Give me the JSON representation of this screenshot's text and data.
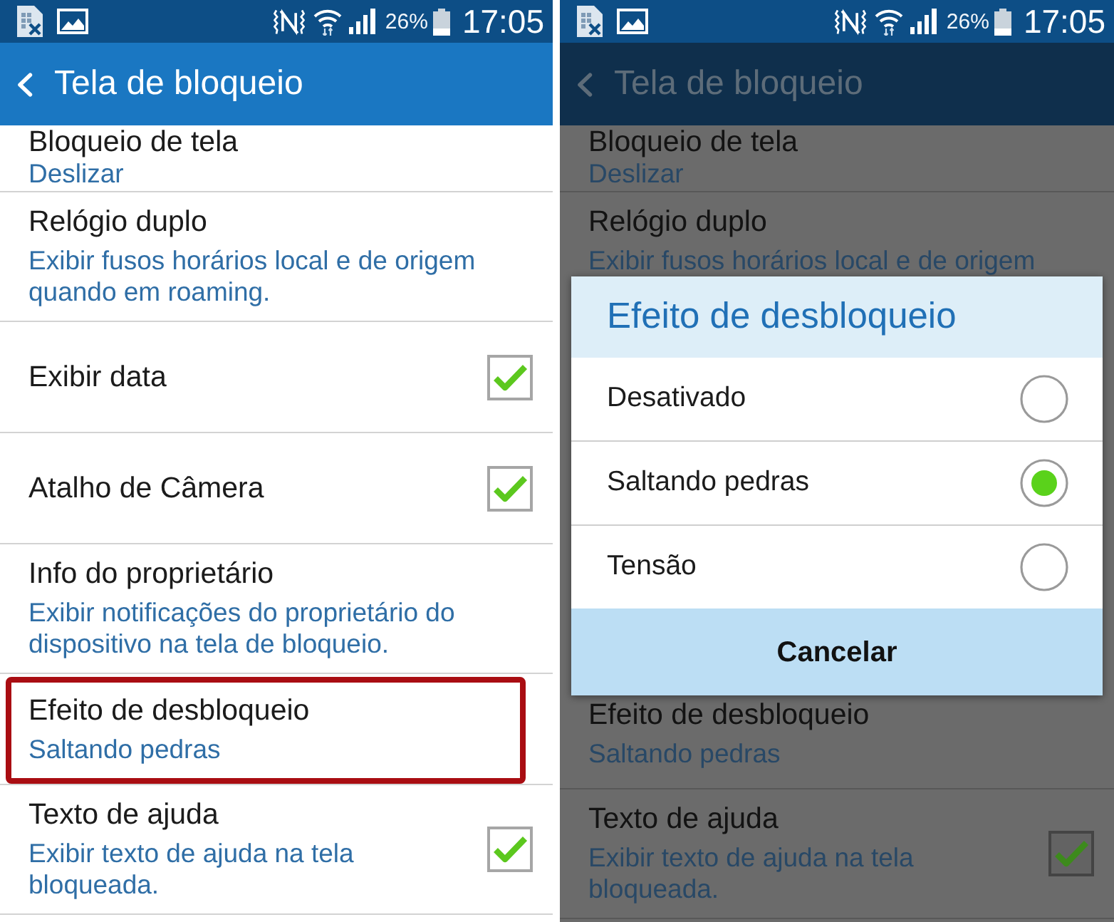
{
  "screens": [
    {
      "status_bar": {
        "battery": "26%",
        "time": "17:05"
      },
      "app_bar": {
        "title": "Tela de bloqueio"
      },
      "settings": [
        {
          "kind": "text",
          "title": "Bloqueio de tela",
          "summary": "Deslizar",
          "highlighted": false
        },
        {
          "kind": "text",
          "title": "Relógio duplo",
          "summary": "Exibir fusos horários local e de origem quando em roaming.",
          "highlighted": false
        },
        {
          "kind": "checkbox",
          "title": "Exibir data",
          "checked": true,
          "highlighted": false
        },
        {
          "kind": "checkbox",
          "title": "Atalho de Câmera",
          "checked": true,
          "highlighted": false
        },
        {
          "kind": "text",
          "title": "Info do proprietário",
          "summary": "Exibir notificações do proprietário do dispositivo na tela de bloqueio.",
          "highlighted": false
        },
        {
          "kind": "text",
          "title": "Efeito de desbloqueio",
          "summary": "Saltando pedras",
          "highlighted": true
        },
        {
          "kind": "checkbox",
          "title": "Texto de ajuda",
          "summary": "Exibir texto de ajuda na tela bloqueada.",
          "checked": true,
          "highlighted": false
        }
      ]
    },
    {
      "status_bar": {
        "battery": "26%",
        "time": "17:05"
      },
      "app_bar": {
        "title": "Tela de bloqueio"
      },
      "settings": [
        {
          "kind": "text",
          "title": "Bloqueio de tela",
          "summary": "Deslizar",
          "highlighted": false
        },
        {
          "kind": "text",
          "title": "Relógio duplo",
          "summary": "Exibir fusos horários local e de origem",
          "highlighted": false
        }
      ],
      "dialog": {
        "title": "Efeito de desbloqueio",
        "options": [
          {
            "label": "Desativado",
            "selected": false
          },
          {
            "label": "Saltando pedras",
            "selected": true
          },
          {
            "label": "Tensão",
            "selected": false
          }
        ],
        "cancel": "Cancelar"
      },
      "settings_below_dialog": [
        {
          "kind": "text",
          "title": "Efeito de desbloqueio",
          "summary": "Saltando pedras",
          "highlighted": false
        },
        {
          "kind": "checkbox",
          "title": "Texto de ajuda",
          "summary": "Exibir texto de ajuda na tela bloqueada.",
          "checked": true,
          "highlighted": false
        }
      ]
    }
  ]
}
